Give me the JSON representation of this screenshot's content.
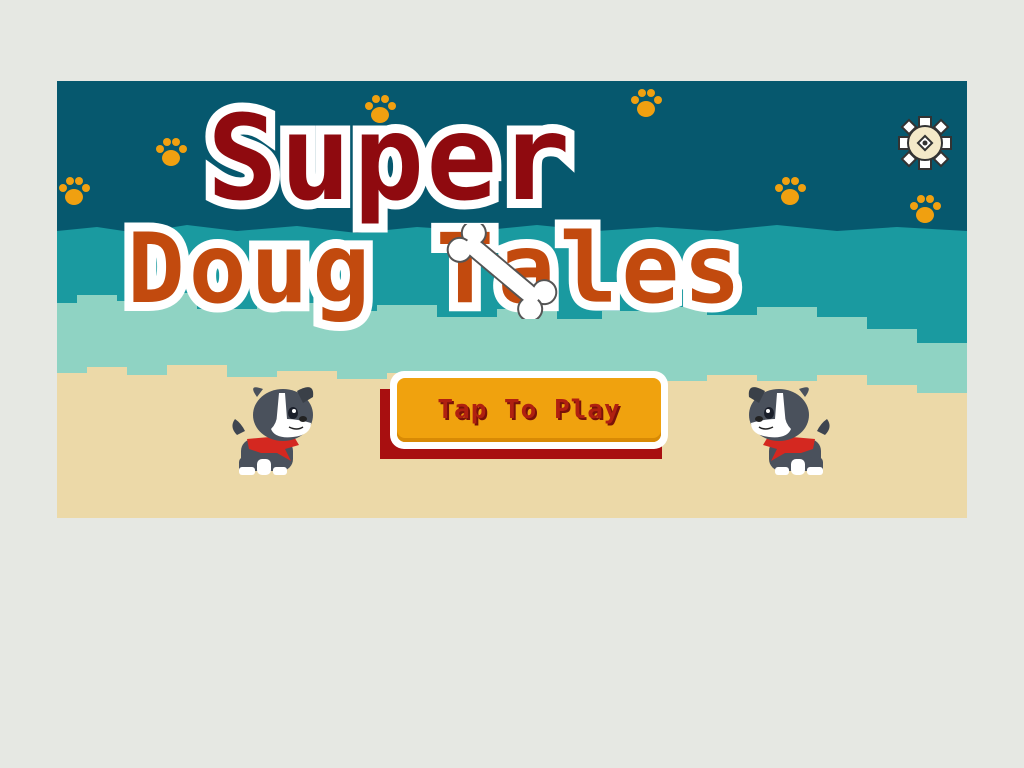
{
  "game": {
    "title_line1": "Super",
    "title_line2": "Doug Tales",
    "play_button_label": "Tap To Play",
    "settings_icon": "gear-icon",
    "paw_icon": "paw-print-icon",
    "bone_icon": "bone-icon",
    "character": "puppy-with-red-bandana"
  },
  "colors": {
    "page_background": "#e6e8e3",
    "sky_dark": "#06586e",
    "sky_teal": "#1a9aa0",
    "cloud_mint": "#8fd3c3",
    "sand": "#ecd9a8",
    "title_red": "#8f0a0f",
    "title_orange": "#c24a0e",
    "paw_orange": "#f0a010",
    "button_orange": "#f0a20e",
    "button_text": "#b02010"
  }
}
